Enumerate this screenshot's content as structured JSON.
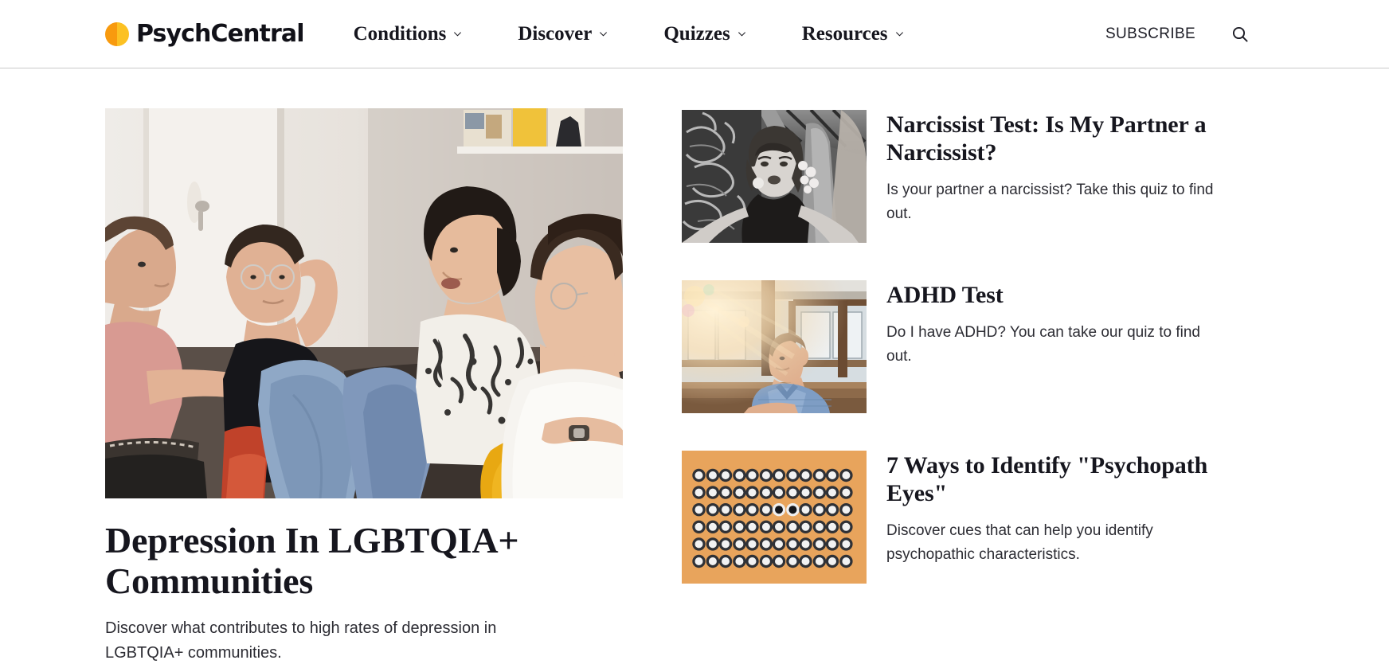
{
  "header": {
    "brand": {
      "name": "PsychCentral",
      "mark_color_left": "#F89A0E",
      "mark_color_right": "#FCC123"
    },
    "nav": [
      {
        "label": "Conditions",
        "has_dropdown": true
      },
      {
        "label": "Discover",
        "has_dropdown": true
      },
      {
        "label": "Quizzes",
        "has_dropdown": true
      },
      {
        "label": "Resources",
        "has_dropdown": true
      }
    ],
    "subscribe_label": "SUBSCRIBE",
    "search_icon": "search-icon"
  },
  "feature": {
    "image_alt": "Four young friends sitting together on a sofa in a living room having a conversation",
    "title": "Depression In LGBTQIA+ Communities",
    "dek": "Discover what contributes to high rates of depression in LGBTQIA+ communities."
  },
  "sidebar": {
    "promos": [
      {
        "title": "Narcissist Test: Is My Partner a Narcissist?",
        "dek": "Is your partner a narcissist? Take this quiz to find out.",
        "image_alt": "Black and white photo of a young woman taking a selfie in front of a graffiti wall",
        "thumb_style": "bw-portrait"
      },
      {
        "title": "ADHD Test",
        "dek": "Do I have ADHD? You can take our quiz to find out.",
        "image_alt": "Man in a blue button-up shirt sitting indoors with warm sunlight flare",
        "thumb_style": "sunlit-man"
      },
      {
        "title": "7 Ways to Identify \"Psychopath Eyes\"",
        "dek": "Discover cues that can help you identify psychopathic characteristics.",
        "image_alt": "Grid of googly eyes on an orange background with one pair of dark pupils in the center",
        "thumb_style": "eyes-grid",
        "thumb_bg": "#E8A45C"
      }
    ]
  }
}
